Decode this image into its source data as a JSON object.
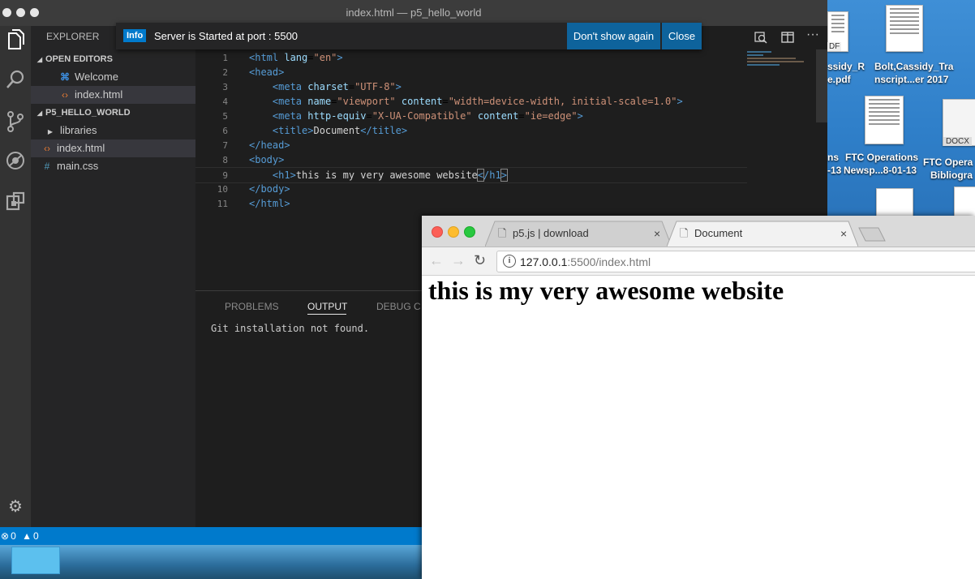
{
  "vscode": {
    "window_title": "index.html — p5_hello_world",
    "explorer_header": "EXPLORER",
    "sections": {
      "open_editors": "OPEN EDITORS",
      "project": "P5_HELLO_WORLD"
    },
    "open_editors": [
      {
        "label": "Welcome",
        "icon": "vscode-icon"
      },
      {
        "label": "index.html",
        "icon": "html-icon"
      }
    ],
    "project_items": [
      {
        "label": "libraries",
        "icon": "folder-chevron-icon"
      },
      {
        "label": "index.html",
        "icon": "html-icon"
      },
      {
        "label": "main.css",
        "icon": "css-hash-icon"
      }
    ],
    "notification": {
      "badge": "Info",
      "message": "Server is Started at port : 5500",
      "dont_show": "Don't show again",
      "close": "Close"
    },
    "code_lines": [
      {
        "n": "1",
        "html": "<span class=\"tag\">&lt;html</span> <span class=\"attr\">lang</span>=<span class=\"str\">\"en\"</span><span class=\"tag\">&gt;</span>"
      },
      {
        "n": "2",
        "html": "<span class=\"tag\">&lt;head&gt;</span>"
      },
      {
        "n": "3",
        "html": "    <span class=\"tag\">&lt;meta</span> <span class=\"attr\">charset</span>=<span class=\"str\">\"UTF-8\"</span><span class=\"tag\">&gt;</span>"
      },
      {
        "n": "4",
        "html": "    <span class=\"tag\">&lt;meta</span> <span class=\"attr\">name</span>=<span class=\"str\">\"viewport\"</span> <span class=\"attr\">content</span>=<span class=\"str\">\"width=device-width, initial-scale=1.0\"</span><span class=\"tag\">&gt;</span>"
      },
      {
        "n": "5",
        "html": "    <span class=\"tag\">&lt;meta</span> <span class=\"attr\">http-equiv</span>=<span class=\"str\">\"X-UA-Compatible\"</span> <span class=\"attr\">content</span>=<span class=\"str\">\"ie=edge\"</span><span class=\"tag\">&gt;</span>"
      },
      {
        "n": "6",
        "html": "    <span class=\"tag\">&lt;title&gt;</span><span class=\"txt\">Document</span><span class=\"tag\">&lt;/title&gt;</span>"
      },
      {
        "n": "7",
        "html": "<span class=\"tag\">&lt;/head&gt;</span>"
      },
      {
        "n": "8",
        "html": "<span class=\"tag\">&lt;body&gt;</span>"
      },
      {
        "n": "9",
        "html": "    <span class=\"tag\">&lt;h1&gt;</span><span class=\"txt\">this is my very awesome website</span><span class=\"tag bk\">&lt;</span><span class=\"tag\">/h1</span><span class=\"tag bk\">&gt;</span>"
      },
      {
        "n": "10",
        "html": "<span class=\"tag\">&lt;/body&gt;</span>"
      },
      {
        "n": "11",
        "html": "<span class=\"tag\">&lt;/html&gt;</span>"
      }
    ],
    "panel": {
      "tabs": [
        "PROBLEMS",
        "OUTPUT",
        "DEBUG C"
      ],
      "active_tab": "OUTPUT",
      "output": "Git installation not found."
    },
    "status": {
      "errors": "0",
      "warnings": "0"
    }
  },
  "desktop": {
    "icons": [
      {
        "label1": "ssidy_R",
        "label2": "e.pdf"
      },
      {
        "label1": "Bolt,Cassidy_Tra",
        "label2": "nscript...er 2017"
      },
      {
        "label1": "ns",
        "label2": "-13"
      },
      {
        "label1": "FTC Operations",
        "label2": "Newsp...8-01-13"
      },
      {
        "label1": "FTC Opera",
        "label2": "Bibliogra"
      }
    ],
    "docx_tag": "DOCX",
    "pdf_tag": "DF"
  },
  "chrome": {
    "tabs": [
      {
        "label": "p5.js | download",
        "active": false
      },
      {
        "label": "Document",
        "active": true
      }
    ],
    "url_host": "127.0.0.1",
    "url_rest": ":5500/index.html",
    "page_heading": "this is my very awesome website"
  },
  "colors": {
    "vscode_accent": "#007acc",
    "html_tag": "#569cd6",
    "html_attr": "#9cdcfe",
    "html_string": "#ce9178"
  }
}
